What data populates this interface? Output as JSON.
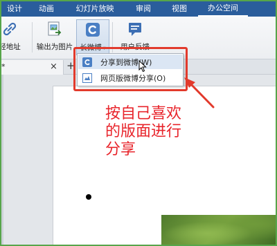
{
  "menu": {
    "tabs": [
      "设计",
      "动画",
      "幻灯片放映",
      "审阅",
      "视图",
      "办公空间"
    ],
    "active": "办公空间"
  },
  "ribbon": {
    "partial_label": "轻地址",
    "export_image_label": "输出为图片",
    "long_weibo_label": "长微博",
    "feedback_label": "用户反馈"
  },
  "document_tab": {
    "name": "*"
  },
  "dropdown": {
    "items": [
      {
        "label": "分享到微博(W)",
        "icon": "weibo-c-icon"
      },
      {
        "label": "网页版微博分享(O)",
        "icon": "web-weibo-icon"
      }
    ]
  },
  "annotation": {
    "lines": [
      "按自己喜欢",
      "的版面进行",
      "分享"
    ],
    "color": "#e8242b"
  },
  "colors": {
    "menubar": "#2a5d9c",
    "highlight": "#e23a2c",
    "accent": "#3d6fb4"
  }
}
